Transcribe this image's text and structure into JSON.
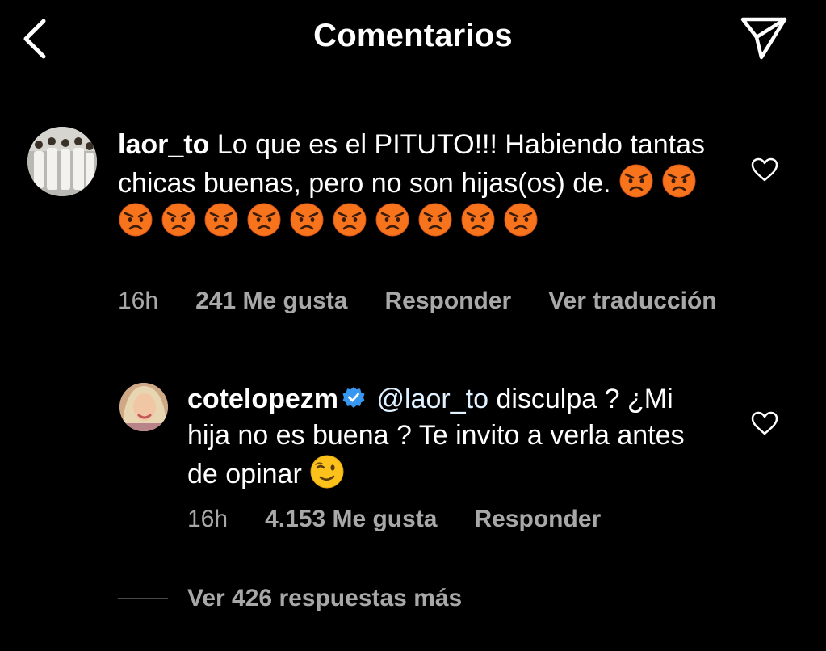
{
  "header": {
    "title": "Comentarios",
    "back_icon": "chevron-left-icon",
    "share_icon": "paper-plane-icon"
  },
  "comments": [
    {
      "username": "laor_to",
      "text": "Lo que es el PITUTO!!! Habiendo tantas chicas buenas, pero no son hijas(os) de.",
      "emoji": "angry-face",
      "emoji_count": 12,
      "time": "16h",
      "likes": "241 Me gusta",
      "reply_label": "Responder",
      "translate_label": "Ver traducción",
      "verified": false
    },
    {
      "username": "cotelopezm",
      "mention": "@laor_to",
      "text": "disculpa ? ¿Mi hija no es buena ? Te invito a verla antes de opinar",
      "emoji": "winking-face",
      "time": "16h",
      "likes": "4.153 Me gusta",
      "reply_label": "Responder",
      "verified": true
    }
  ],
  "more_replies": "Ver 426 respuestas más",
  "colors": {
    "background": "#000000",
    "text": "#ffffff",
    "secondary_text": "#a8a8a8",
    "verified": "#3897f0",
    "angry_emoji": "#f7731c"
  }
}
